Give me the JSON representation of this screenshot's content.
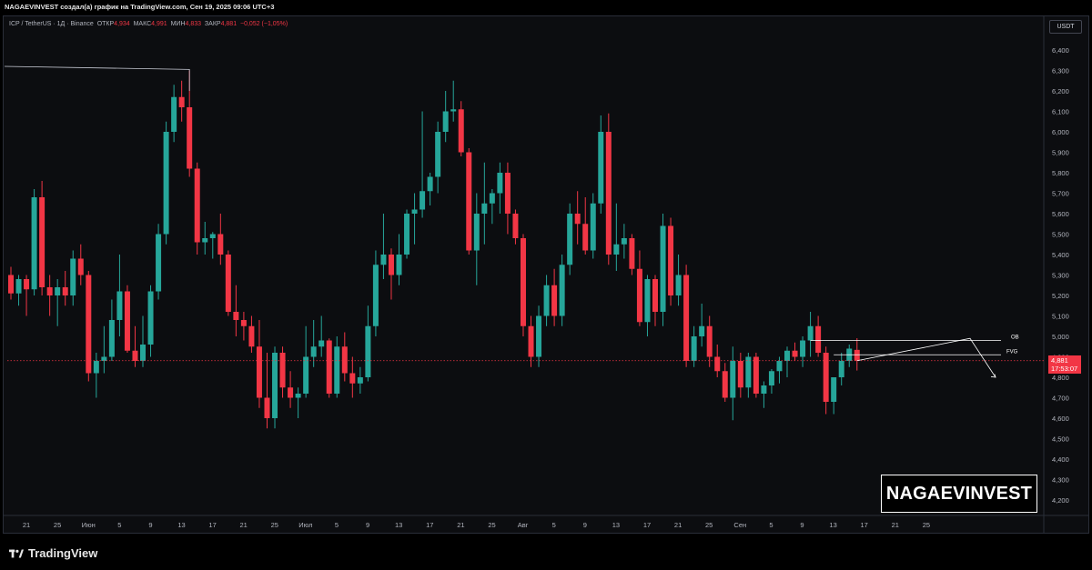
{
  "header": {
    "attribution": "NAGAEVINVEST создал(а) график на TradingView.com, Сен 19, 2025 09:06 UTC+3"
  },
  "legend": {
    "symbol": "ICP / TetherUS · 1Д · Binance",
    "open_label": "ОТКР",
    "open_value": "4,934",
    "high_label": "МАКС",
    "high_value": "4,991",
    "low_label": "МИН",
    "low_value": "4,833",
    "close_label": "ЗАКР",
    "close_value": "4,881",
    "change": "−0,052 (−1,05%)"
  },
  "currency_button": "USDT",
  "price_tag": {
    "price": "4,881",
    "countdown": "17:53:07"
  },
  "annotations": {
    "ob": "OB",
    "fvg": "FVG"
  },
  "watermark": "NAGAEVINVEST",
  "footer": {
    "brand": "TradingView"
  },
  "colors": {
    "up": "#26a69a",
    "down": "#f23645",
    "background": "#0c0d10"
  },
  "chart_data": {
    "type": "candlestick",
    "y_ticks": [
      "4,200",
      "4,300",
      "4,400",
      "4,500",
      "4,600",
      "4,700",
      "4,800",
      "4,900",
      "5,000",
      "5,100",
      "5,200",
      "5,300",
      "5,400",
      "5,500",
      "5,600",
      "5,700",
      "5,800",
      "5,900",
      "6,000",
      "6,100",
      "6,200",
      "6,300",
      "6,400"
    ],
    "ylim": [
      4150,
      6500
    ],
    "x_ticks": [
      "21",
      "25",
      "Июн",
      "5",
      "9",
      "13",
      "17",
      "21",
      "25",
      "Июл",
      "5",
      "9",
      "13",
      "17",
      "21",
      "25",
      "Авг",
      "5",
      "9",
      "13",
      "17",
      "21",
      "25",
      "Сен",
      "5",
      "9",
      "13",
      "17",
      "21",
      "25"
    ],
    "grid": false,
    "current_price": 4881,
    "ob_level": 4980,
    "fvg_level": 4910,
    "series": [
      {
        "values": [
          [
            5300,
            5340,
            5180,
            5210
          ],
          [
            5210,
            5300,
            5150,
            5280
          ],
          [
            5280,
            5300,
            5100,
            5230
          ],
          [
            5230,
            5720,
            5200,
            5680
          ],
          [
            5680,
            5760,
            5200,
            5240
          ],
          [
            5240,
            5300,
            5100,
            5200
          ],
          [
            5200,
            5280,
            5050,
            5240
          ],
          [
            5240,
            5320,
            5150,
            5200
          ],
          [
            5200,
            5420,
            5150,
            5380
          ],
          [
            5380,
            5450,
            5250,
            5300
          ],
          [
            5300,
            5320,
            4780,
            4820
          ],
          [
            4820,
            4920,
            4700,
            4880
          ],
          [
            4880,
            5050,
            4820,
            4900
          ],
          [
            4900,
            5180,
            4880,
            5080
          ],
          [
            5080,
            5400,
            5000,
            5220
          ],
          [
            5220,
            5250,
            4920,
            4930
          ],
          [
            4930,
            5050,
            4850,
            4880
          ],
          [
            4880,
            5100,
            4850,
            4960
          ],
          [
            4960,
            5250,
            4900,
            5220
          ],
          [
            5220,
            5550,
            5180,
            5500
          ],
          [
            5500,
            6050,
            5450,
            6000
          ],
          [
            6000,
            6230,
            5950,
            6170
          ],
          [
            6170,
            6250,
            6050,
            6120
          ],
          [
            6120,
            6300,
            5780,
            5820
          ],
          [
            5820,
            5850,
            5400,
            5460
          ],
          [
            5460,
            5560,
            5400,
            5480
          ],
          [
            5480,
            5510,
            5380,
            5500
          ],
          [
            5500,
            5600,
            5350,
            5400
          ],
          [
            5400,
            5420,
            5100,
            5120
          ],
          [
            5120,
            5250,
            5000,
            5080
          ],
          [
            5080,
            5120,
            4980,
            5050
          ],
          [
            5050,
            5100,
            4920,
            4950
          ],
          [
            4950,
            5080,
            4650,
            4700
          ],
          [
            4700,
            4920,
            4550,
            4600
          ],
          [
            4600,
            4950,
            4550,
            4920
          ],
          [
            4920,
            4950,
            4700,
            4750
          ],
          [
            4750,
            4830,
            4650,
            4700
          ],
          [
            4700,
            4750,
            4600,
            4720
          ],
          [
            4720,
            5050,
            4700,
            4900
          ],
          [
            4900,
            5080,
            4850,
            4950
          ],
          [
            4950,
            5100,
            4900,
            4980
          ],
          [
            4980,
            4990,
            4700,
            4720
          ],
          [
            4720,
            5000,
            4700,
            4950
          ],
          [
            4950,
            5020,
            4780,
            4820
          ],
          [
            4820,
            4900,
            4700,
            4770
          ],
          [
            4770,
            4850,
            4720,
            4800
          ],
          [
            4800,
            5150,
            4780,
            5050
          ],
          [
            5050,
            5420,
            5000,
            5350
          ],
          [
            5350,
            5600,
            5280,
            5400
          ],
          [
            5400,
            5430,
            5180,
            5300
          ],
          [
            5300,
            5500,
            5250,
            5400
          ],
          [
            5400,
            5620,
            5380,
            5600
          ],
          [
            5600,
            5700,
            5450,
            5620
          ],
          [
            5620,
            6100,
            5580,
            5710
          ],
          [
            5710,
            5800,
            5640,
            5780
          ],
          [
            5780,
            6050,
            5700,
            6000
          ],
          [
            6000,
            6200,
            5950,
            6100
          ],
          [
            6100,
            6250,
            6050,
            6110
          ],
          [
            6110,
            6150,
            5880,
            5900
          ],
          [
            5900,
            5920,
            5400,
            5420
          ],
          [
            5420,
            5700,
            5250,
            5600
          ],
          [
            5600,
            5850,
            5450,
            5650
          ],
          [
            5650,
            5720,
            5550,
            5700
          ],
          [
            5700,
            5850,
            5600,
            5800
          ],
          [
            5800,
            5850,
            5500,
            5600
          ],
          [
            5600,
            5620,
            5450,
            5480
          ],
          [
            5480,
            5500,
            5000,
            5050
          ],
          [
            5050,
            5100,
            4850,
            4900
          ],
          [
            4900,
            5150,
            4850,
            5100
          ],
          [
            5100,
            5300,
            5050,
            5250
          ],
          [
            5250,
            5330,
            5050,
            5100
          ],
          [
            5100,
            5400,
            5050,
            5350
          ],
          [
            5350,
            5650,
            5300,
            5600
          ],
          [
            5600,
            5710,
            5450,
            5550
          ],
          [
            5550,
            5680,
            5400,
            5420
          ],
          [
            5420,
            5700,
            5380,
            5650
          ],
          [
            5650,
            6080,
            5600,
            6000
          ],
          [
            6000,
            6090,
            5350,
            5400
          ],
          [
            5400,
            5650,
            5320,
            5450
          ],
          [
            5450,
            5550,
            5380,
            5480
          ],
          [
            5480,
            5500,
            5300,
            5330
          ],
          [
            5330,
            5420,
            5050,
            5070
          ],
          [
            5070,
            5300,
            5000,
            5280
          ],
          [
            5280,
            5300,
            5050,
            5120
          ],
          [
            5120,
            5600,
            5050,
            5540
          ],
          [
            5540,
            5580,
            5150,
            5200
          ],
          [
            5200,
            5400,
            5150,
            5300
          ],
          [
            5300,
            5350,
            4850,
            4880
          ],
          [
            4880,
            5050,
            4850,
            5000
          ],
          [
            5000,
            5160,
            4950,
            5050
          ],
          [
            5050,
            5100,
            4850,
            4900
          ],
          [
            4900,
            4960,
            4800,
            4830
          ],
          [
            4830,
            4870,
            4680,
            4700
          ],
          [
            4700,
            4950,
            4590,
            4880
          ],
          [
            4880,
            4920,
            4700,
            4750
          ],
          [
            4750,
            4920,
            4700,
            4900
          ],
          [
            4900,
            4920,
            4700,
            4720
          ],
          [
            4720,
            4780,
            4650,
            4760
          ],
          [
            4760,
            4840,
            4720,
            4830
          ],
          [
            4830,
            4900,
            4770,
            4880
          ],
          [
            4880,
            4950,
            4800,
            4930
          ],
          [
            4930,
            4970,
            4880,
            4900
          ],
          [
            4900,
            5000,
            4850,
            4980
          ],
          [
            4980,
            5120,
            4900,
            5050
          ],
          [
            5050,
            5100,
            4900,
            4920
          ],
          [
            4920,
            4950,
            4620,
            4680
          ],
          [
            4680,
            4800,
            4620,
            4800
          ],
          [
            4800,
            4920,
            4760,
            4880
          ],
          [
            4880,
            4960,
            4850,
            4940
          ],
          [
            4934,
            4991,
            4833,
            4881
          ]
        ]
      }
    ]
  }
}
